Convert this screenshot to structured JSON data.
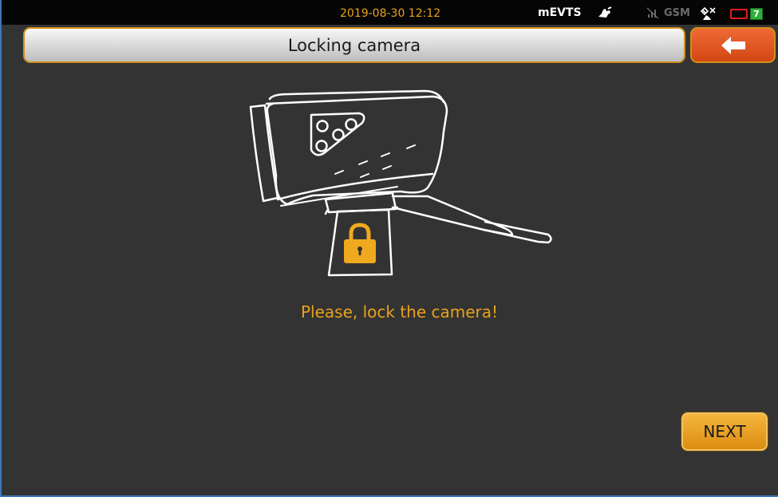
{
  "status_bar": {
    "datetime": "2019-08-30 12:12",
    "app_name": "mEVTS",
    "network_label": "GSM",
    "battery_level": "7",
    "icons": [
      "hand-icon",
      "no-signal-icon",
      "satellite-off-icon",
      "battery-icon"
    ]
  },
  "header": {
    "title": "Locking camera",
    "back_icon": "arrow-left-icon"
  },
  "main": {
    "illustration": "locked-camera-icon",
    "instruction": "Please, lock the camera!",
    "next_label": "NEXT"
  },
  "colors": {
    "background": "#333333",
    "accent": "#e8a21c",
    "back_button": "#e1561e",
    "status_bar": "#050505"
  }
}
